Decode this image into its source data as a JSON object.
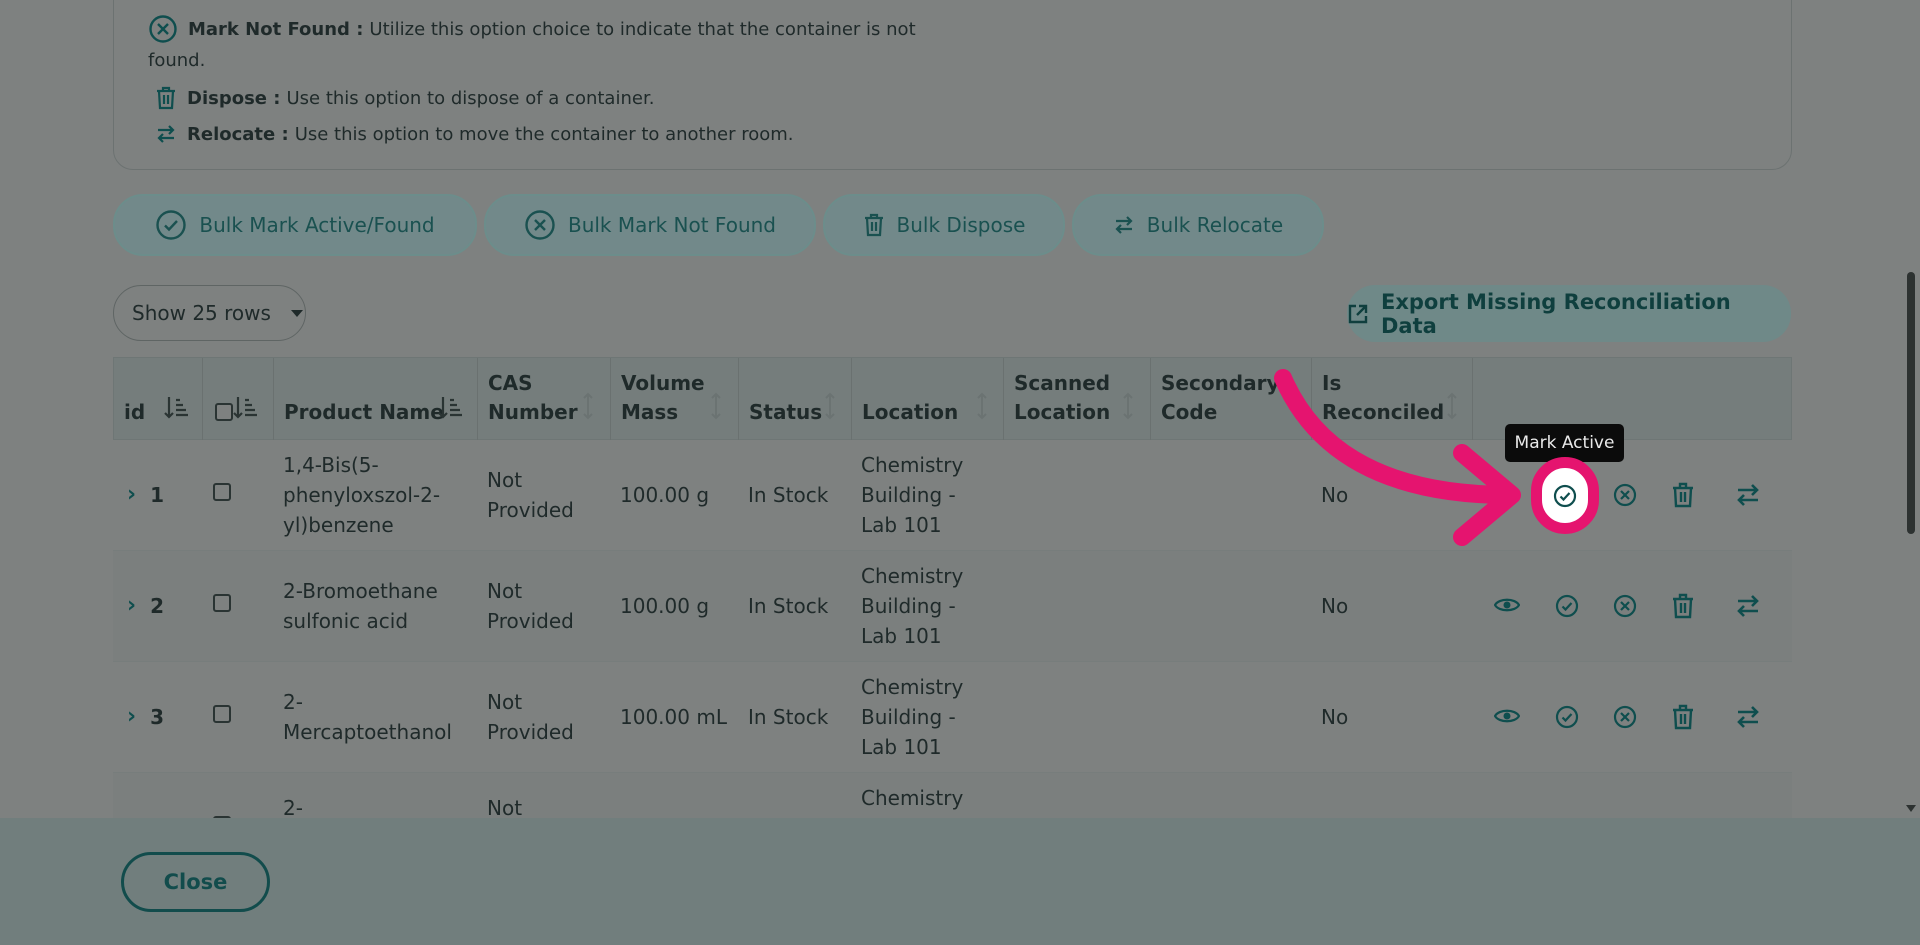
{
  "legend": {
    "mark_not_found": {
      "title": "Mark Not Found :",
      "text": "Utilize this option choice to indicate that the container is not",
      "text_cont": "found."
    },
    "dispose": {
      "title": "Dispose :",
      "text": "Use this option to dispose of a container."
    },
    "relocate": {
      "title": "Relocate :",
      "text": "Use this option to move the container to another room."
    }
  },
  "bulk_actions": {
    "mark_active": "Bulk Mark Active/Found",
    "mark_not_found": "Bulk Mark Not Found",
    "dispose": "Bulk Dispose",
    "relocate": "Bulk Relocate"
  },
  "rows_select": {
    "selected": "Show 25 rows"
  },
  "export_button": "Export Missing Reconciliation Data",
  "table": {
    "headers": {
      "id": "id",
      "product_name": "Product Name",
      "cas_1": "CAS",
      "cas_2": "Number",
      "vol_1": "Volume",
      "vol_2": "Mass",
      "status": "Status",
      "location": "Location",
      "scanned_1": "Scanned",
      "scanned_2": "Location",
      "secondary_1": "Secondary",
      "secondary_2": "Code",
      "reconciled_1": "Is",
      "reconciled_2": "Reconciled"
    },
    "rows": [
      {
        "id": "1",
        "name_1": "1,4-Bis(5-",
        "name_2": "phenyloxszol-2-",
        "name_3": "yl)benzene",
        "cas_1": "Not",
        "cas_2": "Provided",
        "volume": "100.00 g",
        "status": "In Stock",
        "loc_1": "Chemistry",
        "loc_2": "Building -",
        "loc_3": "Lab 101",
        "reconciled": "No"
      },
      {
        "id": "2",
        "name_1": "2-Bromoethane",
        "name_2": "sulfonic acid",
        "name_3": "",
        "cas_1": "Not",
        "cas_2": "Provided",
        "volume": "100.00 g",
        "status": "In Stock",
        "loc_1": "Chemistry",
        "loc_2": "Building -",
        "loc_3": "Lab 101",
        "reconciled": "No"
      },
      {
        "id": "3",
        "name_1": "2-",
        "name_2": "Mercaptoethanol",
        "name_3": "",
        "cas_1": "Not",
        "cas_2": "Provided",
        "volume": "100.00 mL",
        "status": "In Stock",
        "loc_1": "Chemistry",
        "loc_2": "Building -",
        "loc_3": "Lab 101",
        "reconciled": "No"
      },
      {
        "name_1": "2-",
        "cas_1": "Not",
        "loc_1": "Chemistry"
      }
    ]
  },
  "tooltip": "Mark Active",
  "close_button": "Close",
  "colors": {
    "accent": "#0f4e4e",
    "highlight": "#e5146f",
    "overlay": "#7e8180"
  },
  "icons": [
    "circle-x-icon",
    "trash-icon",
    "swap-arrows-icon",
    "circle-check-icon",
    "eye-icon",
    "sort-icon",
    "chevron-right-icon",
    "export-icon"
  ]
}
